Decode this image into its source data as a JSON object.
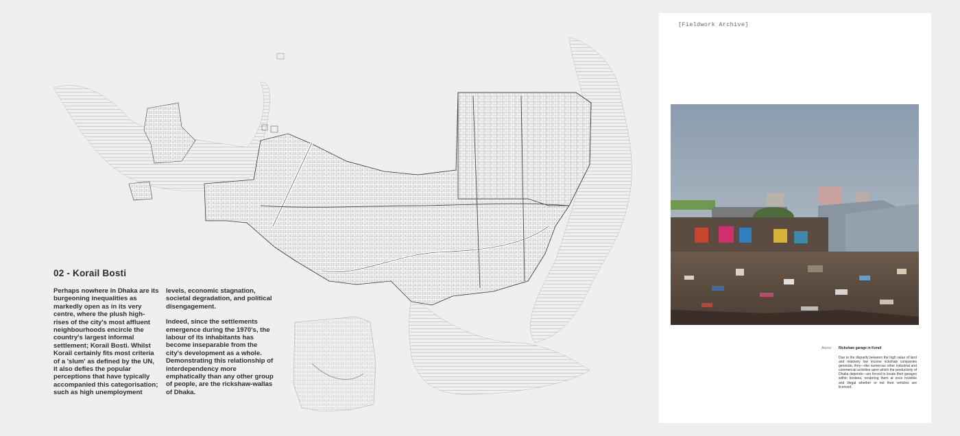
{
  "page": {
    "background": "#efefef",
    "right_page_background": "#ffffff"
  },
  "left": {
    "section_title": "02 - Korail Bosti",
    "column_a": "Perhaps nowhere in Dhaka are its burgeoning inequalities as markedly open as in its very centre, where the plush high-rises of the city's most affluent neighbourhoods encircle the country's largest informal settlement; Korail Bosti. Whilst Korail certainly fits most criteria of a 'slum' as defined by the UN, it also defies the popular perceptions that have typically accompanied this categorisation; such as high unemployment",
    "column_b_p1": "levels, economic stagnation, societal degradation, and political disengagement.",
    "column_b_p2": "Indeed, since the settlements emergence during the 1970's, the labour of its inhabitants has become inseparable from the city's development as a whole. Demonstrating this relationship of interdependency more emphatically than any other group of people, are the rickshaw-wallas of Dhaka."
  },
  "right": {
    "archive_label": "[Fieldwork Archive]",
    "caption_prefix": "Above:",
    "caption_title": "Rickshaw garage in Korail",
    "caption_body": "Due to the disparity between the high value of land and relatively low income rickshaw companies generate, they—like numerous other industrial and commercial activities upon which the productivity of Dhaka depends—are forced to locate their garages within bostees, rendering them at once invisible and illegal whether or not their vehicles are licensed."
  },
  "icons": {
    "map": "settlement-plan-drawing",
    "photo": "rickshaw-garage-photo"
  }
}
